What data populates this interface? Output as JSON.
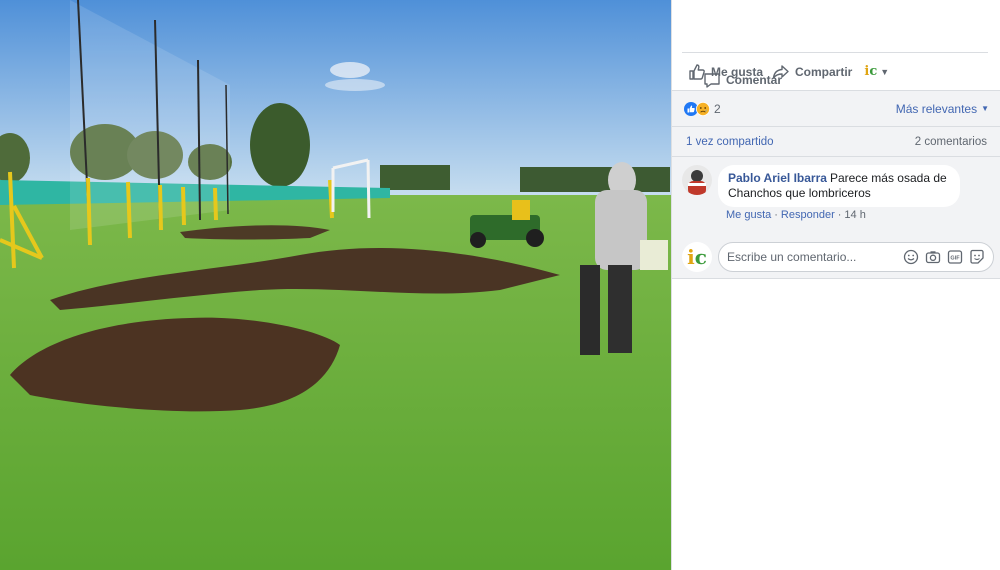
{
  "photo": {
    "alt_subject": ""
  },
  "actions": {
    "like_label": "Me gusta",
    "comment_label": "Comentar",
    "share_label": "Compartir",
    "page_logo": "ic"
  },
  "reactions": {
    "count": "2",
    "types": [
      "like-icon",
      "sad-icon"
    ],
    "sort_label": "Más relevantes"
  },
  "shares": {
    "share_count_label": "1 vez compartido",
    "comment_count_label": "2 comentarios"
  },
  "comment": {
    "author": "Pablo Ariel Ibarra",
    "text": "Parece más osada de Chanchos que lombriceros",
    "like_label": "Me gusta",
    "reply_label": "Responder",
    "time": "14 h"
  },
  "composer": {
    "placeholder": "Escribe un comentario...",
    "logo": "ic",
    "icons": [
      "emoji-icon",
      "camera-icon",
      "gif-icon",
      "sticker-icon"
    ]
  },
  "colors": {
    "link": "#4267b2",
    "author": "#385898",
    "muted": "#606770",
    "panel_bg": "#f2f3f5",
    "like_blue": "#2078f4",
    "sad_yellow": "#f7b125"
  }
}
